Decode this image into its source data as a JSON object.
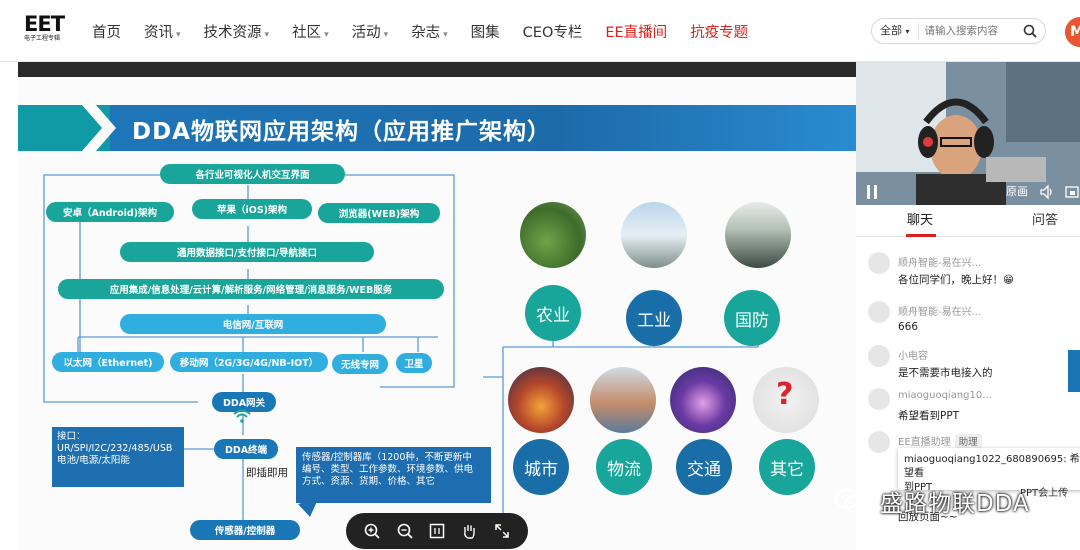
{
  "logo": {
    "mark": "EET",
    "sub": "电子工程专辑"
  },
  "nav": [
    {
      "label": "首页",
      "caret": false,
      "red": false
    },
    {
      "label": "资讯",
      "caret": true,
      "red": false
    },
    {
      "label": "技术资源",
      "caret": true,
      "red": false
    },
    {
      "label": "社区",
      "caret": true,
      "red": false
    },
    {
      "label": "活动",
      "caret": true,
      "red": false
    },
    {
      "label": "杂志",
      "caret": true,
      "red": false
    },
    {
      "label": "图集",
      "caret": false,
      "red": false
    },
    {
      "label": "CEO专栏",
      "caret": false,
      "red": false
    },
    {
      "label": "EE直播间",
      "caret": false,
      "red": true
    },
    {
      "label": "抗疫专题",
      "caret": false,
      "red": true
    }
  ],
  "search": {
    "scope": "全部",
    "placeholder": "请输入搜索内容"
  },
  "user": {
    "initial": "M"
  },
  "slide": {
    "title": "DDA物联网应用架构（应用推广架构）",
    "boxes": {
      "hmi": "各行业可视化人机交互界面",
      "android": "安卓（Android)架构",
      "ios": "苹果（iOS)架构",
      "web": "浏览器(WEB)架构",
      "api": "通用数据接口/支付接口/导航接口",
      "services": "应用集成/信息处理/云计算/解析服务/网络管理/消息服务/WEB服务",
      "telecom": "电信网/互联网",
      "ethernet": "以太网（Ethernet)",
      "mobile": "移动网（2G/3G/4G/NB-IOT）",
      "wireless": "无线专网",
      "satellite": "卫星",
      "gateway": "DDA网关",
      "terminal": "DDA终端",
      "sensor": "传感器/控制器"
    },
    "port_box": [
      "接口：",
      "UR/SPI/I2C/232/485/USB",
      "电池/电源/太阳能"
    ],
    "sensor_box": [
      "传感器/控制器库（1200种，不断更新中",
      "编号、类型、工作参数、环境参数、供电",
      "方式、资源、货期、价格、其它"
    ],
    "plug_play": "即插即用",
    "sectors": [
      "农业",
      "工业",
      "国防",
      "城市",
      "物流",
      "交通",
      "其它"
    ]
  },
  "watermark": "盛路物联DDA",
  "cam": {
    "original": "原画"
  },
  "tabs": [
    {
      "label": "聊天",
      "active": true
    },
    {
      "label": "问答",
      "active": false
    }
  ],
  "chat": [
    {
      "nick": "顺舟智能-易在兴...",
      "text": "各位同学们，晚上好！😁",
      "badge": ""
    },
    {
      "nick": "顺舟智能-易在兴...",
      "text": "666",
      "badge": ""
    },
    {
      "nick": "小电容",
      "text": "是不需要市电接入的",
      "badge": ""
    },
    {
      "nick": "miaoguoqiang10...",
      "text": "希望看到PPT",
      "badge": ""
    },
    {
      "nick": "EE直播助理",
      "text": "回放页面~~",
      "badge": "助理"
    }
  ],
  "tooltip": [
    "miaoguoqiang1022_680890695: 希望看",
    "到PPT"
  ],
  "tooltip_tail": "PPT会上传"
}
